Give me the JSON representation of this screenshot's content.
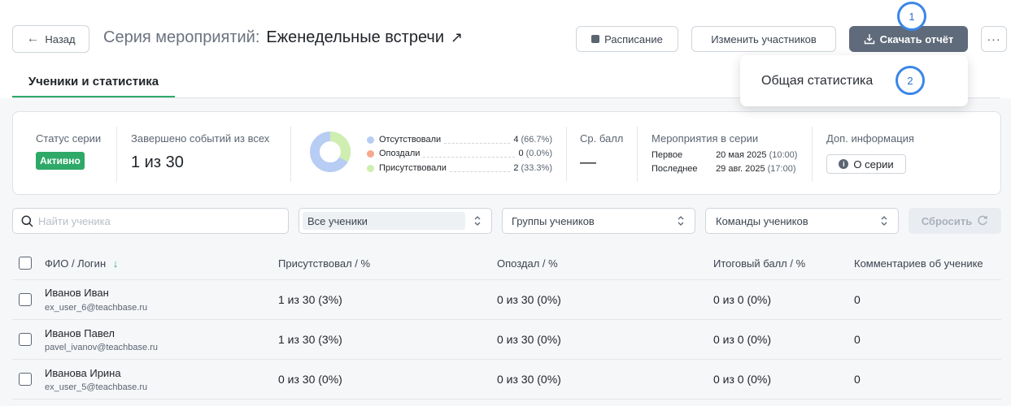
{
  "header": {
    "back_label": "Назад",
    "title_prefix": "Серия мероприятий:",
    "title_name": "Еженедельные встречи",
    "schedule_label": "Расписание",
    "members_label": "Изменить участников",
    "download_label": "Скачать отчёт",
    "more_label": "···"
  },
  "markers": {
    "one": "1",
    "two": "2"
  },
  "dropdown": {
    "item": "Общая статистика"
  },
  "tabs": {
    "active": "Ученики и статистика"
  },
  "stats": {
    "status_label": "Статус серии",
    "status_value": "Активно",
    "completed_label": "Завершено событий из всех",
    "completed_value": "1 из 30",
    "attendance": [
      {
        "name": "Отсутствовали",
        "count": "4",
        "percent": "(66.7%)",
        "color": "#b8cdf3"
      },
      {
        "name": "Опоздали",
        "count": "0",
        "percent": "(0.0%)",
        "color": "#f5a98d"
      },
      {
        "name": "Присутствовали",
        "count": "2",
        "percent": "(33.3%)",
        "color": "#cfeeb0"
      }
    ],
    "avg_label": "Ср. балл",
    "avg_value": "—",
    "events_label": "Мероприятия в серии",
    "first_label": "Первое",
    "first_date": "20 мая 2025",
    "first_time": "(10:00)",
    "last_label": "Последнее",
    "last_date": "29 авг. 2025",
    "last_time": "(17:00)",
    "extra_label": "Доп. информация",
    "about_label": "О серии"
  },
  "filters": {
    "search_placeholder": "Найти ученика",
    "students": "Все ученики",
    "groups": "Группы учеников",
    "teams": "Команды учеников",
    "reset": "Сбросить"
  },
  "table": {
    "headers": {
      "name": "ФИО / Логин",
      "present": "Присутствовал / %",
      "late": "Опоздал / %",
      "score": "Итоговый балл / %",
      "comments": "Комментариев об ученике"
    },
    "rows": [
      {
        "name": "Иванов Иван",
        "login": "ex_user_6@teachbase.ru",
        "present": "1 из 30 (3%)",
        "late": "0 из 30 (0%)",
        "score": "0 из 0 (0%)",
        "comments": "0"
      },
      {
        "name": "Иванов Павел",
        "login": "pavel_ivanov@teachbase.ru",
        "present": "1 из 30 (3%)",
        "late": "0 из 30 (0%)",
        "score": "0 из 0 (0%)",
        "comments": "0"
      },
      {
        "name": "Иванова Ирина",
        "login": "ex_user_5@teachbase.ru",
        "present": "0 из 30 (0%)",
        "late": "0 из 30 (0%)",
        "score": "0 из 0 (0%)",
        "comments": "0"
      }
    ]
  }
}
